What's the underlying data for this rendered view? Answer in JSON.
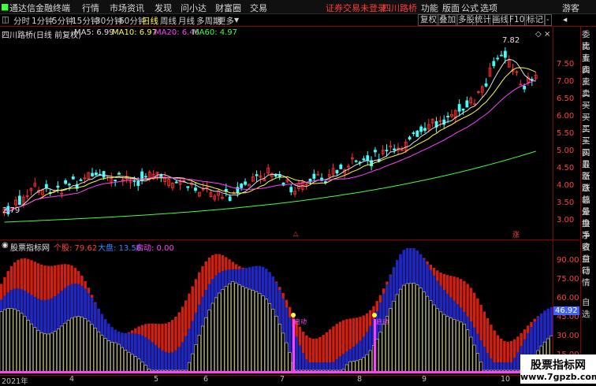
{
  "menu": {
    "app_title": "通达信金融终端",
    "items": [
      "行情",
      "市场",
      "资讯",
      "发现",
      "问小达",
      "财富圈",
      "交易"
    ],
    "warning": "证券交易未登录",
    "stock": "四川路桥",
    "right_items": [
      "功能",
      "版面",
      "公式",
      "选项",
      "游客"
    ]
  },
  "periods": {
    "items": [
      "分时",
      "1分钟",
      "5分钟",
      "15分钟",
      "30分钟",
      "60分钟",
      "日线",
      "周线",
      "月线",
      "多周期",
      "更多"
    ],
    "selected": "日线",
    "tools": [
      "复权",
      "叠加",
      "多股",
      "统计",
      "画线",
      "F10",
      "标记",
      "-"
    ]
  },
  "main_chart": {
    "legend_title": "四川路桥(日线 前复权)",
    "ma": [
      {
        "label": "MA5: 6.99",
        "color": "#e0e0e0"
      },
      {
        "label": "MA10: 6.97",
        "color": "#ffff40"
      },
      {
        "label": "MA20: 6.46",
        "color": "#ff40ff"
      },
      {
        "label": "MA60: 4.97",
        "color": "#40ff40"
      }
    ],
    "y_ticks": [
      "7.50",
      "7.00",
      "6.50",
      "6.00",
      "5.50",
      "5.00",
      "4.50",
      "4.00",
      "3.50",
      "3.00"
    ],
    "high_label": "7.82",
    "low_label": "2.79",
    "event_marks": [
      "△",
      "涨"
    ]
  },
  "sub_chart": {
    "title": "股票指标网",
    "individual": "个股: 79.62",
    "market": "大盘: 13.56",
    "tip": "启动: 0.00",
    "y_ticks": [
      "90.00",
      "75.00",
      "60.00",
      "45.00",
      "30.00",
      "15.00"
    ],
    "current_value": "46.92",
    "signal_text": "启动"
  },
  "dates": [
    "2021年",
    "4",
    "5",
    "6",
    "7",
    "8",
    "9",
    "10"
  ],
  "right_column": [
    "委比",
    "卖五",
    "卖四",
    "卖三",
    "卖二",
    "卖一",
    "买一",
    "买二",
    "买三",
    "买四",
    "买五",
    "最新",
    "涨跌",
    "涨幅",
    "总量",
    "外盘",
    "换手",
    "净资",
    "收益",
    "自动",
    "行情",
    "自选"
  ],
  "watermark": {
    "line1": "股票指标网",
    "line2": "www.7gpzb.com"
  },
  "colors": {
    "up": "#ff3030",
    "down": "#40ffff",
    "ma5": "#e0e0e0",
    "ma10": "#ffff40",
    "ma20": "#ff40ff",
    "ma60": "#40ff40"
  }
}
